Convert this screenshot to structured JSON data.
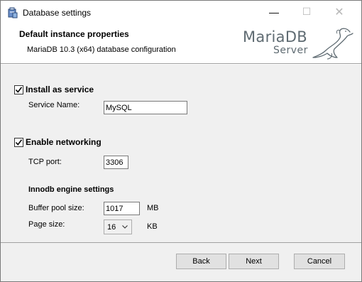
{
  "window": {
    "title": "Database settings",
    "minimize_glyph": "—",
    "maximize_glyph": "☐",
    "close_glyph": "✕"
  },
  "header": {
    "title": "Default instance properties",
    "subtitle": "MariaDB 10.3 (x64) database configuration",
    "logo": {
      "line1": "MariaDB",
      "line2": "Server",
      "icon": "sea-lion-icon"
    }
  },
  "service": {
    "checkbox_label": "Install as service",
    "checked": true,
    "name_label": "Service Name:",
    "name_value": "MySQL"
  },
  "networking": {
    "checkbox_label": "Enable networking",
    "checked": true,
    "port_label": "TCP port:",
    "port_value": "3306"
  },
  "innodb": {
    "heading": "Innodb engine settings",
    "buffer_label": "Buffer pool size:",
    "buffer_value": "1017",
    "buffer_unit": "MB",
    "page_label": "Page size:",
    "page_value": "16",
    "page_unit": "KB"
  },
  "buttons": {
    "back": "Back",
    "next": "Next",
    "cancel": "Cancel"
  },
  "colors": {
    "panel_bg": "#f0f0f0",
    "logo_gray": "#5f6b72",
    "button_bg": "#e1e1e1"
  }
}
